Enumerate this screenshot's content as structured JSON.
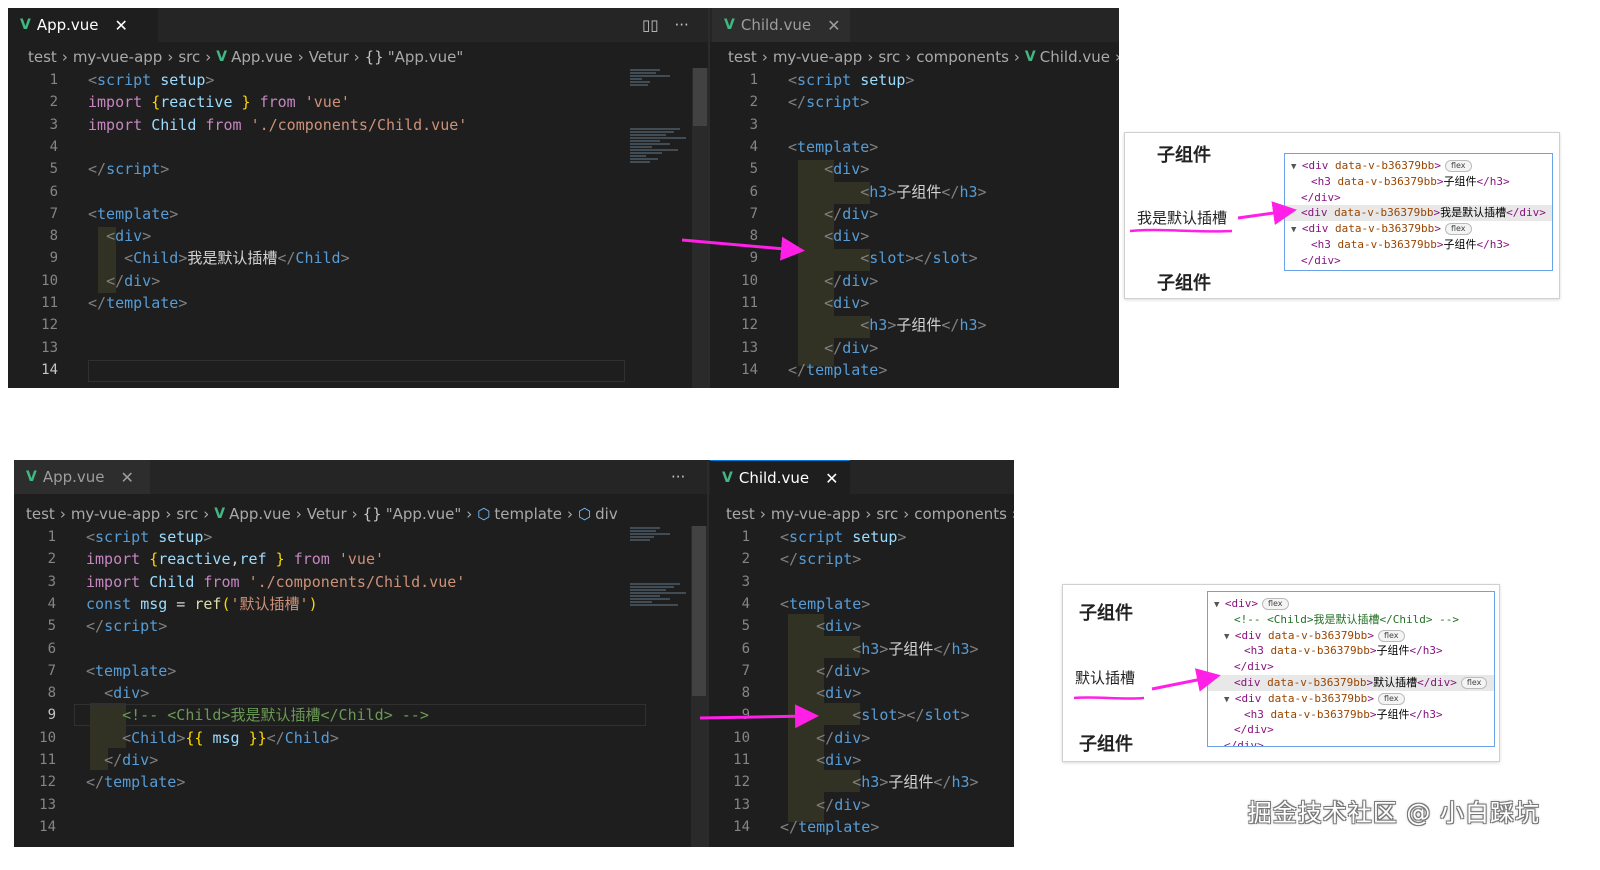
{
  "colors": {
    "editor_bg": "#1e1e1e",
    "vue_green": "#41b883",
    "arrow": "#ff1fe6",
    "highlight": "#ff1fe6",
    "devtools_border": "#6aa3e8"
  },
  "icons": {
    "vue": "vue-logo-icon",
    "close": "close-icon",
    "split": "split-editor-icon",
    "more": "more-actions-icon",
    "braces": "braces-symbol-icon",
    "cube": "cube-symbol-icon"
  },
  "top": {
    "left": {
      "tab": {
        "label": "App.vue",
        "close": "✕"
      },
      "actions": {
        "split": "▯▯",
        "more": "···"
      },
      "breadcrumb": [
        "test",
        "my-vue-app",
        "src",
        "App.vue",
        "Vetur",
        "\"App.vue\""
      ],
      "line_numbers": [
        "1",
        "2",
        "3",
        "4",
        "5",
        "6",
        "7",
        "8",
        "9",
        "10",
        "11",
        "12",
        "13",
        "14"
      ],
      "current_line": "14"
    },
    "right": {
      "tab": {
        "label": "Child.vue",
        "close": "✕"
      },
      "breadcrumb": [
        "test",
        "my-vue-app",
        "src",
        "components",
        "Child.vue"
      ],
      "line_numbers": [
        "1",
        "2",
        "3",
        "4",
        "5",
        "6",
        "7",
        "8",
        "9",
        "10",
        "11",
        "12",
        "13",
        "14"
      ]
    },
    "result": {
      "heading1": "子组件",
      "slot_text": "我是默认插槽",
      "heading2": "子组件",
      "devtools": [
        {
          "tag": "div",
          "attr": "data-v-b36379bb",
          "text": "",
          "close": "",
          "badge": "flex"
        },
        {
          "tag": "h3",
          "attr": "data-v-b36379bb",
          "text": "子组件",
          "close": "</h3>",
          "badge": ""
        },
        {
          "tag": "/div",
          "attr": "",
          "text": "",
          "close": "",
          "badge": ""
        },
        {
          "tag": "div",
          "attr": "data-v-b36379bb",
          "text": "我是默认插槽",
          "close": "</div>",
          "badge": ""
        },
        {
          "tag": "div",
          "attr": "data-v-b36379bb",
          "text": "",
          "close": "",
          "badge": "flex"
        },
        {
          "tag": "h3",
          "attr": "data-v-b36379bb",
          "text": "子组件",
          "close": "</h3>",
          "badge": ""
        },
        {
          "tag": "/div",
          "attr": "",
          "text": "",
          "close": "",
          "badge": ""
        }
      ]
    }
  },
  "bottom": {
    "left": {
      "tab": {
        "label": "App.vue",
        "close": "✕"
      },
      "actions": {
        "more": "···"
      },
      "breadcrumb": [
        "test",
        "my-vue-app",
        "src",
        "App.vue",
        "Vetur",
        "\"App.vue\"",
        "template",
        "div"
      ],
      "line_numbers": [
        "1",
        "2",
        "3",
        "4",
        "5",
        "6",
        "7",
        "8",
        "9",
        "10",
        "11",
        "12",
        "13",
        "14"
      ],
      "current_line": "9"
    },
    "right": {
      "tab": {
        "label": "Child.vue",
        "close": "✕"
      },
      "breadcrumb": [
        "test",
        "my-vue-app",
        "src",
        "components"
      ],
      "line_numbers": [
        "1",
        "2",
        "3",
        "4",
        "5",
        "6",
        "7",
        "8",
        "9",
        "10",
        "11",
        "12",
        "13",
        "14"
      ]
    },
    "result": {
      "heading1": "子组件",
      "slot_text": "默认插槽",
      "heading2": "子组件",
      "devtools": [
        {
          "tag": "div",
          "attr": "",
          "text": "",
          "close": "",
          "badge": "flex"
        },
        {
          "comment": "<!-- <Child>我是默认插槽</Child> -->"
        },
        {
          "tag": "div",
          "attr": "data-v-b36379bb",
          "text": "",
          "close": "",
          "badge": "flex"
        },
        {
          "tag": "h3",
          "attr": "data-v-b36379bb",
          "text": "子组件",
          "close": "</h3>",
          "badge": ""
        },
        {
          "tag": "/div",
          "attr": "",
          "text": "",
          "close": "",
          "badge": ""
        },
        {
          "tag": "div",
          "attr": "data-v-b36379bb",
          "text": "默认插槽",
          "close": "</div>",
          "badge": "flex"
        },
        {
          "tag": "div",
          "attr": "data-v-b36379bb",
          "text": "",
          "close": "",
          "badge": "flex"
        },
        {
          "tag": "h3",
          "attr": "data-v-b36379bb",
          "text": "子组件",
          "close": "</h3>",
          "badge": ""
        },
        {
          "tag": "/div",
          "attr": "",
          "text": "",
          "close": "",
          "badge": ""
        },
        {
          "tag": "/div",
          "attr": "",
          "text": "",
          "close": "",
          "badge": ""
        }
      ]
    }
  },
  "code": {
    "top_app": [
      [
        [
          "p",
          "<"
        ],
        [
          "t",
          "script"
        ],
        [
          "w",
          " "
        ],
        [
          "a",
          "setup"
        ],
        [
          "p",
          ">"
        ]
      ],
      [
        [
          "i",
          "import"
        ],
        [
          "w",
          " "
        ],
        [
          "br",
          "{"
        ],
        [
          "v",
          "reactive"
        ],
        [
          "w",
          " "
        ],
        [
          "br",
          "}"
        ],
        [
          "w",
          " "
        ],
        [
          "i",
          "from"
        ],
        [
          "w",
          " "
        ],
        [
          "s",
          "'vue'"
        ]
      ],
      [
        [
          "i",
          "import"
        ],
        [
          "w",
          " "
        ],
        [
          "v",
          "Child"
        ],
        [
          "w",
          " "
        ],
        [
          "i",
          "from"
        ],
        [
          "w",
          " "
        ],
        [
          "s",
          "'./components/Child.vue'"
        ]
      ],
      [],
      [
        [
          "p",
          "</"
        ],
        [
          "t",
          "script"
        ],
        [
          "p",
          ">"
        ]
      ],
      [],
      [
        [
          "p",
          "<"
        ],
        [
          "t",
          "template"
        ],
        [
          "p",
          ">"
        ]
      ],
      [
        [
          "w",
          "  "
        ],
        [
          "p",
          "<"
        ],
        [
          "t",
          "div"
        ],
        [
          "p",
          ">"
        ]
      ],
      [
        [
          "w",
          "    "
        ],
        [
          "p",
          "<"
        ],
        [
          "t",
          "Child"
        ],
        [
          "p",
          ">"
        ],
        [
          "w",
          "我是默认插槽"
        ],
        [
          "p",
          "</"
        ],
        [
          "t",
          "Child"
        ],
        [
          "p",
          ">"
        ]
      ],
      [
        [
          "w",
          "  "
        ],
        [
          "p",
          "</"
        ],
        [
          "t",
          "div"
        ],
        [
          "p",
          ">"
        ]
      ],
      [
        [
          "p",
          "</"
        ],
        [
          "t",
          "template"
        ],
        [
          "p",
          ">"
        ]
      ],
      [],
      [],
      []
    ],
    "child": [
      [
        [
          "p",
          "<"
        ],
        [
          "t",
          "script"
        ],
        [
          "w",
          " "
        ],
        [
          "a",
          "setup"
        ],
        [
          "p",
          ">"
        ]
      ],
      [
        [
          "p",
          "</"
        ],
        [
          "t",
          "script"
        ],
        [
          "p",
          ">"
        ]
      ],
      [],
      [
        [
          "p",
          "<"
        ],
        [
          "t",
          "template"
        ],
        [
          "p",
          ">"
        ]
      ],
      [
        [
          "w",
          "    "
        ],
        [
          "p",
          "<"
        ],
        [
          "t",
          "div"
        ],
        [
          "p",
          ">"
        ]
      ],
      [
        [
          "w",
          "        "
        ],
        [
          "p",
          "<"
        ],
        [
          "t",
          "h3"
        ],
        [
          "p",
          ">"
        ],
        [
          "w",
          "子组件"
        ],
        [
          "p",
          "</"
        ],
        [
          "t",
          "h3"
        ],
        [
          "p",
          ">"
        ]
      ],
      [
        [
          "w",
          "    "
        ],
        [
          "p",
          "</"
        ],
        [
          "t",
          "div"
        ],
        [
          "p",
          ">"
        ]
      ],
      [
        [
          "w",
          "    "
        ],
        [
          "p",
          "<"
        ],
        [
          "t",
          "div"
        ],
        [
          "p",
          ">"
        ]
      ],
      [
        [
          "w",
          "        "
        ],
        [
          "p",
          "<"
        ],
        [
          "t",
          "slot"
        ],
        [
          "p",
          "></"
        ],
        [
          "t",
          "slot"
        ],
        [
          "p",
          ">"
        ]
      ],
      [
        [
          "w",
          "    "
        ],
        [
          "p",
          "</"
        ],
        [
          "t",
          "div"
        ],
        [
          "p",
          ">"
        ]
      ],
      [
        [
          "w",
          "    "
        ],
        [
          "p",
          "<"
        ],
        [
          "t",
          "div"
        ],
        [
          "p",
          ">"
        ]
      ],
      [
        [
          "w",
          "        "
        ],
        [
          "p",
          "<"
        ],
        [
          "t",
          "h3"
        ],
        [
          "p",
          ">"
        ],
        [
          "w",
          "子组件"
        ],
        [
          "p",
          "</"
        ],
        [
          "t",
          "h3"
        ],
        [
          "p",
          ">"
        ]
      ],
      [
        [
          "w",
          "    "
        ],
        [
          "p",
          "</"
        ],
        [
          "t",
          "div"
        ],
        [
          "p",
          ">"
        ]
      ],
      [
        [
          "p",
          "</"
        ],
        [
          "t",
          "template"
        ],
        [
          "p",
          ">"
        ]
      ]
    ],
    "bottom_app": [
      [
        [
          "p",
          "<"
        ],
        [
          "t",
          "script"
        ],
        [
          "w",
          " "
        ],
        [
          "a",
          "setup"
        ],
        [
          "p",
          ">"
        ]
      ],
      [
        [
          "i",
          "import"
        ],
        [
          "w",
          " "
        ],
        [
          "br",
          "{"
        ],
        [
          "v",
          "reactive"
        ],
        [
          "w",
          ","
        ],
        [
          "v",
          "ref"
        ],
        [
          "w",
          " "
        ],
        [
          "br",
          "}"
        ],
        [
          "w",
          " "
        ],
        [
          "i",
          "from"
        ],
        [
          "w",
          " "
        ],
        [
          "s",
          "'vue'"
        ]
      ],
      [
        [
          "i",
          "import"
        ],
        [
          "w",
          " "
        ],
        [
          "v",
          "Child"
        ],
        [
          "w",
          " "
        ],
        [
          "i",
          "from"
        ],
        [
          "w",
          " "
        ],
        [
          "s",
          "'./components/Child.vue'"
        ]
      ],
      [
        [
          "k",
          "const"
        ],
        [
          "w",
          " "
        ],
        [
          "v",
          "msg"
        ],
        [
          "w",
          " = "
        ],
        [
          "f",
          "ref"
        ],
        [
          "br",
          "("
        ],
        [
          "s",
          "'默认插槽'"
        ],
        [
          "br",
          ")"
        ]
      ],
      [
        [
          "p",
          "</"
        ],
        [
          "t",
          "script"
        ],
        [
          "p",
          ">"
        ]
      ],
      [],
      [
        [
          "p",
          "<"
        ],
        [
          "t",
          "template"
        ],
        [
          "p",
          ">"
        ]
      ],
      [
        [
          "w",
          "  "
        ],
        [
          "p",
          "<"
        ],
        [
          "t",
          "div"
        ],
        [
          "p",
          ">"
        ]
      ],
      [
        [
          "w",
          "    "
        ],
        [
          "c",
          "<!-- <Child>我是默认插槽</Child> -->"
        ]
      ],
      [
        [
          "w",
          "    "
        ],
        [
          "p",
          "<"
        ],
        [
          "t",
          "Child"
        ],
        [
          "p",
          ">"
        ],
        [
          "br",
          "{{"
        ],
        [
          "w",
          " "
        ],
        [
          "v",
          "msg"
        ],
        [
          "w",
          " "
        ],
        [
          "br",
          "}}"
        ],
        [
          "p",
          "</"
        ],
        [
          "t",
          "Child"
        ],
        [
          "p",
          ">"
        ]
      ],
      [
        [
          "w",
          "  "
        ],
        [
          "p",
          "</"
        ],
        [
          "t",
          "div"
        ],
        [
          "p",
          ">"
        ]
      ],
      [
        [
          "p",
          "</"
        ],
        [
          "t",
          "template"
        ],
        [
          "p",
          ">"
        ]
      ],
      [],
      []
    ]
  },
  "watermark": "掘金技术社区 @ 小白踩坑"
}
